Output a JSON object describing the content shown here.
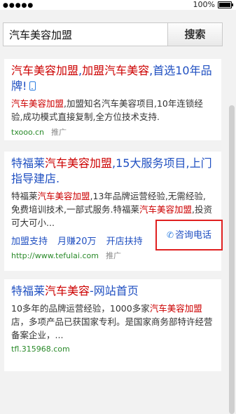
{
  "status_bar": {
    "signal": "●●●●●",
    "battery_pct": "100%",
    "battery_level": 1.0
  },
  "search": {
    "value": "汽车美容加盟",
    "button_label": "搜索"
  },
  "results": [
    {
      "title_parts": [
        "汽车美容加盟",
        ",",
        "加盟汽车美容",
        ",首选10年品牌!"
      ],
      "desc_parts": [
        "汽车美容加盟",
        ",加盟知名汽车美容项目,10年连锁经验,成功模式直接复制,全方位技术支持."
      ],
      "url": "txooo.cn",
      "ad_label": "推广"
    },
    {
      "title_parts": [
        "特福莱",
        "汽车美容加盟",
        ",15大服务项目,上门指导建店."
      ],
      "desc_parts": [
        "特福莱",
        "汽车美容加盟",
        ",13年品牌运营经验,无需经验,免费培训技术,一部式服务.特福莱",
        "汽车美容加盟",
        ",投资可大可小..."
      ],
      "sublinks": [
        "加盟支持",
        "月赚20万",
        "开店扶持"
      ],
      "url": "http://www.tefulai.com",
      "ad_label": "推广",
      "cta_label": "咨询电话"
    },
    {
      "title_parts": [
        "特福莱",
        "汽车美容",
        "-网站首页"
      ],
      "desc_parts": [
        "10多年的品牌运营经验，1000多家",
        "汽车美容加盟",
        "店，多项产品已获国家专利。是国家商务部特许经营备案企业，..."
      ],
      "url": "tfl.315968.com"
    }
  ]
}
